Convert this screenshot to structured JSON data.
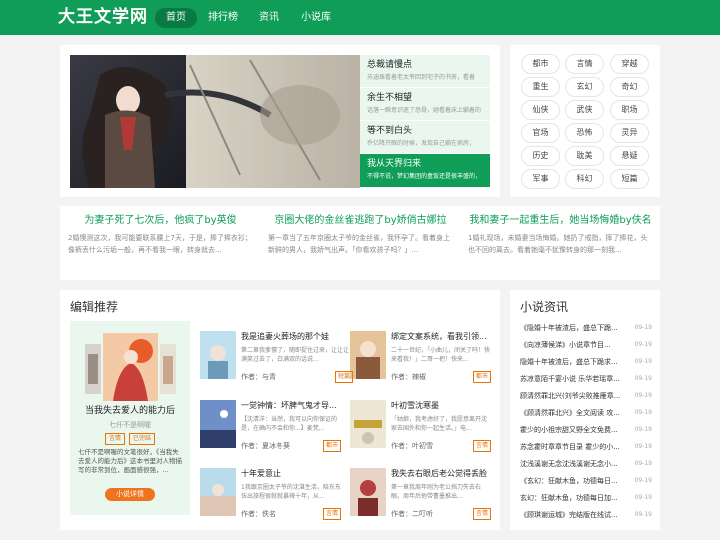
{
  "header": {
    "logo": "大王文学网",
    "nav": [
      "首页",
      "排行榜",
      "资讯",
      "小说库"
    ]
  },
  "slider": {
    "items": [
      {
        "title": "总裁请慢点",
        "desc": "苏涵珠看着老太爷回到宅子的书房，看着"
      },
      {
        "title": "余生不相望",
        "desc": "话落一瞬意识逐了恐骨，她看着床上躺着的"
      },
      {
        "title": "等不到白头",
        "desc": "乔亿降开眼的时候，发现自己躺在病房，"
      },
      {
        "title": "我从天界归来",
        "desc": "不得不说，梦幻集团的盒饭还是很丰盛的，"
      }
    ]
  },
  "tags": [
    "都市",
    "言情",
    "穿越",
    "重生",
    "玄幻",
    "奇幻",
    "仙侠",
    "武侠",
    "职场",
    "官场",
    "恐怖",
    "灵异",
    "历史",
    "耽美",
    "悬疑",
    "军事",
    "科幻",
    "短篇"
  ],
  "featured": [
    {
      "title": "为妻子死了七次后，他疯了by英俊",
      "desc": "2婚懊测这次，我可能要联系腰上7天，于是，捧了捧衣衫；像裤丢什么污垢一般，再不看我一眼，转身就去..."
    },
    {
      "title": "京圈大佬的金丝雀逃跑了by娇俏古娜拉",
      "desc": "第一章当了五年京圈太子爷的金丝雀，我怀孕了。看着身上新鲜的男人，我娇气出声。「你看欢孩子吗？」..."
    },
    {
      "title": "我和妻子一起重生后，她当场悔婚by伕名",
      "desc": "1婚礼现场，未婚妻当场悔婚。她扔了戒指，摔了捧花，头也不回的离去。看着她毫不犹豫转身的那一刻我..."
    }
  ],
  "editor": {
    "heading": "编辑推荐",
    "highlight": {
      "title": "当我失去爱人的能力后",
      "author": "七仟不是啊喔",
      "tags": [
        "言情",
        "已完结"
      ],
      "desc": "七仟不是啊喔的文笔很好，《当我失去爱人的能力后》这本书里对人物描写的非常到位，画面感很强，...",
      "button": "小说详情"
    },
    "books": [
      {
        "title": "我是追妻火葬场的那个娃",
        "desc": "第二章我爹懵了，随即捉住过来，让让让满笑过去了，白满双的话说...",
        "author": "作者：与青",
        "cat": "短篇"
      },
      {
        "title": "绑定文案系统，看我引领...",
        "desc": "二十一世纪，「小曲儿，闭关了吗！快来看我！」二哥一把！快来...",
        "author": "作者：辣椒",
        "cat": "都市"
      },
      {
        "title": "一觉钟情：坏脾气鬼才导...",
        "desc": "【沈清洋：当然，我可以向你保证的是，在确内不会和你...】麦梵...",
        "author": "作者：夏冰冬葵",
        "cat": "都市"
      },
      {
        "title": "叶初雪沈寒墨",
        "desc": "「姑娘，我考虑好了，我愿意离开沈家去国外和你一起生活。」电...",
        "author": "作者：叶初雪",
        "cat": "言情"
      },
      {
        "title": "十年爱意止",
        "desc": "1我跟京圈太子爷的沈湛生活，陪东东伍出旅程很就就暴辣十年，从...",
        "author": "作者：佚名",
        "cat": "言情"
      },
      {
        "title": "我失去右眼后老公觉得丢脸",
        "desc": "第一章我周年刚为老公挡刀失去右眼。周年后他带曹墨推出...",
        "author": "作者：二叮听",
        "cat": "言情"
      }
    ]
  },
  "news": {
    "heading": "小说资讯",
    "items": [
      {
        "title": "《隐婚十年被渣后，盛总下跪...",
        "date": "09-19"
      },
      {
        "title": "《向凉薄候涕》小说章节目...",
        "date": "09-19"
      },
      {
        "title": "隐婚十年被渣后，盛总下跪求...",
        "date": "09-19"
      },
      {
        "title": "苏凉意陌千宴小说 乐华若瑶章...",
        "date": "09-19"
      },
      {
        "title": "顾清然罪北兴(刘爷尖败推雁章...",
        "date": "09-19"
      },
      {
        "title": "《顾清然罪北兴》全文阅读 攻...",
        "date": "09-19"
      },
      {
        "title": "霍少的小祖宗甜又野全文免费...",
        "date": "09-19"
      },
      {
        "title": "苏念霍时章章节目录 霍少的小...",
        "date": "09-19"
      },
      {
        "title": "沈浅溪谢无念沈浅溪谢无念小...",
        "date": "09-19"
      },
      {
        "title": "《玄幻：狂献木鱼，功德每日...",
        "date": "09-19"
      },
      {
        "title": "玄幻：狂献木鱼，功德每日加...",
        "date": "09-19"
      },
      {
        "title": "《顾琪谢运城》完结版在线试...",
        "date": "09-19"
      }
    ]
  }
}
